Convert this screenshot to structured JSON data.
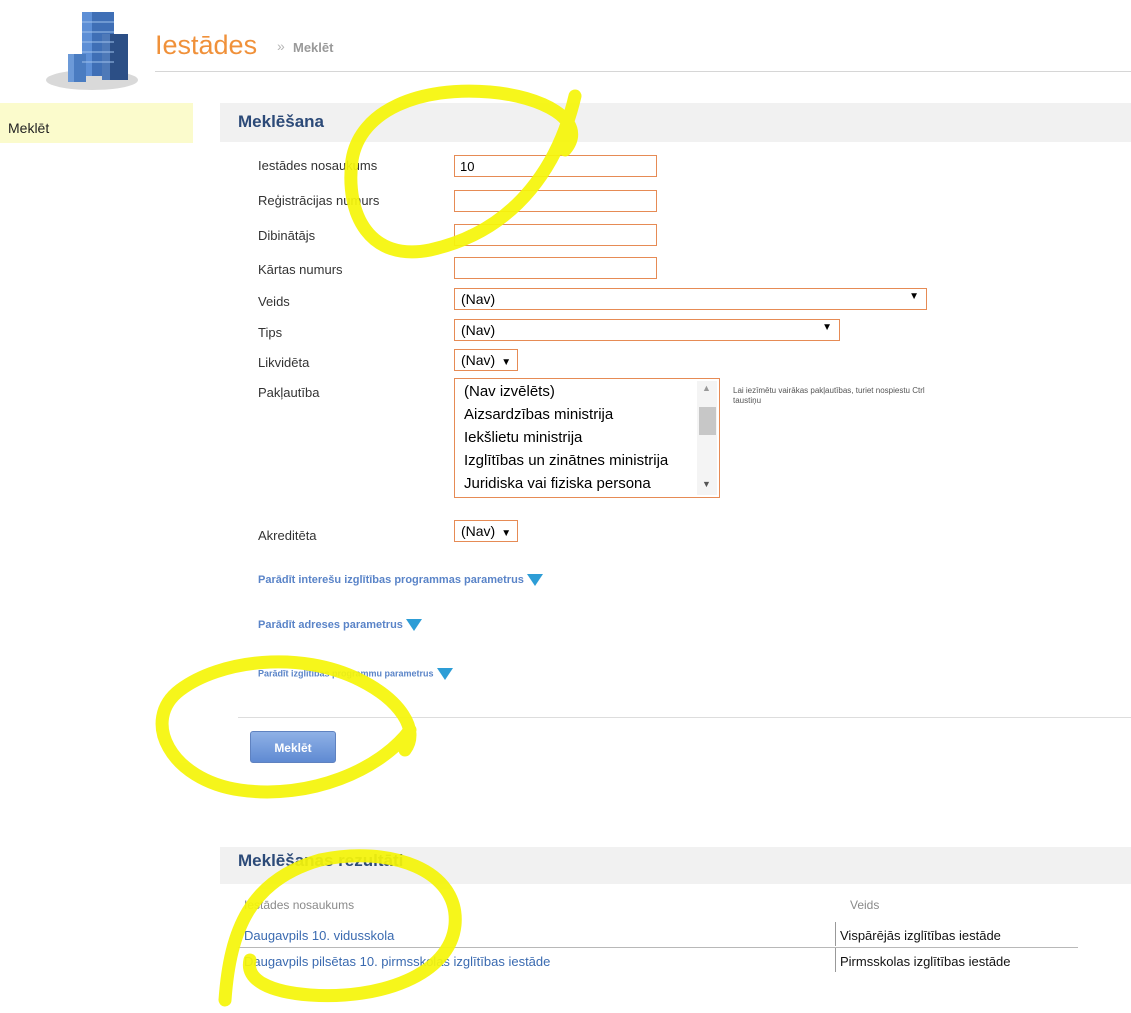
{
  "header": {
    "title": "Iestādes",
    "separator": "»",
    "breadcrumb": "Meklēt"
  },
  "sidebar": {
    "items": [
      {
        "label": "Meklēt"
      }
    ]
  },
  "search": {
    "title": "Meklēšana",
    "fields": {
      "name": {
        "label": "Iestādes nosaukums",
        "value": "10"
      },
      "registration": {
        "label": "Reģistrācijas numurs",
        "value": ""
      },
      "founder": {
        "label": "Dibinātājs",
        "value": ""
      },
      "order_number": {
        "label": "Kārtas numurs",
        "value": ""
      },
      "type": {
        "label": "Veids",
        "value": "(Nav)"
      },
      "tips": {
        "label": "Tips",
        "value": "(Nav)"
      },
      "liquidated": {
        "label": "Likvidēta",
        "value": "(Nav)"
      },
      "subordination": {
        "label": "Pakļautība",
        "options": [
          "(Nav izvēlēts)",
          "Aizsardzības ministrija",
          "Iekšlietu ministrija",
          "Izglītības un zinātnes ministrija",
          "Juridiska vai fiziska persona"
        ],
        "hint": "Lai iezīmētu vairākas pakļautības, turiet nospiestu Ctrl taustiņu"
      },
      "accredited": {
        "label": "Akreditēta",
        "value": "(Nav)"
      }
    },
    "toggles": [
      "Parādīt interešu izglītības programmas parametrus",
      "Parādīt adreses parametrus",
      "Parādīt izglītības programmu parametrus"
    ],
    "submit_label": "Meklēt"
  },
  "results": {
    "title": "Meklēšanas rezultāti",
    "columns": [
      "Iestādes nosaukums",
      "Veids"
    ],
    "rows": [
      {
        "name": "Daugavpils 10. vidusskola",
        "type": "Vispārējās izglītības iestāde"
      },
      {
        "name": "Daugavpils pilsētas 10. pirmsskolas izglītības iestāde",
        "type": "Pirmsskolas izglītības iestāde"
      }
    ]
  },
  "icons": {
    "logo": "building-logo-icon",
    "toggle_arrow": "triangle-down-icon",
    "select_caret": "caret-down-icon"
  },
  "colors": {
    "title_orange": "#f0913a",
    "heading_blue": "#2c4a78",
    "link_blue": "#3a6ab0",
    "input_border": "#e68b55",
    "sidebar_bg": "#fbfbcc",
    "highlight_scribble": "#f5f50a"
  }
}
